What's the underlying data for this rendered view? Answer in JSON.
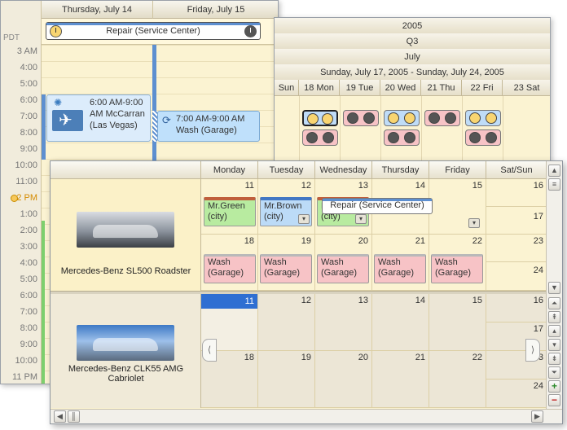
{
  "day_view": {
    "timezone": "PDT",
    "columns": [
      "Thursday, July 14",
      "Friday, July 15"
    ],
    "hours": [
      "3 AM",
      "4:00",
      "5:00",
      "6:00",
      "7:00",
      "8:00",
      "9:00",
      "10:00",
      "11:00",
      "2 PM",
      "1:00",
      "2:00",
      "3:00",
      "4:00",
      "5:00",
      "6:00",
      "7:00",
      "8:00",
      "9:00",
      "10:00",
      "11 PM"
    ],
    "allday_appt": "Repair (Service Center)",
    "appt_flight": "6:00 AM-9:00 AM McCarran (Las Vegas)",
    "appt_wash": "7:00 AM-9:00 AM Wash (Garage)"
  },
  "week_view": {
    "year": "2005",
    "quarter": "Q3",
    "month": "July",
    "range": "Sunday, July 17, 2005 - Sunday, July 24, 2005",
    "days": [
      "Sun",
      "18 Mon",
      "19 Tue",
      "20 Wed",
      "21 Thu",
      "22 Fri",
      "23 Sat"
    ]
  },
  "timeline": {
    "headers": [
      "Monday",
      "Tuesday",
      "Wednesday",
      "Thursday",
      "Friday",
      "Sat/Sun"
    ],
    "resources": [
      {
        "name": "Mercedes-Benz SL500 Roadster",
        "week1": [
          "11",
          "12",
          "13",
          "14",
          "15"
        ],
        "week1_weekend": [
          "16",
          "17"
        ],
        "week2": [
          "18",
          "19",
          "20",
          "21",
          "22"
        ],
        "week2_weekend": [
          "23",
          "24"
        ]
      },
      {
        "name": "Mercedes-Benz CLK55 AMG Cabriolet",
        "week1": [
          "11",
          "12",
          "13",
          "14",
          "15"
        ],
        "week1_weekend": [
          "16",
          "17"
        ],
        "week2": [
          "18",
          "19",
          "20",
          "21",
          "22"
        ],
        "week2_weekend": [
          "23",
          "24"
        ]
      }
    ],
    "events": {
      "mon": "Mr.Green (city)",
      "tue": "Mr.Brown (city)",
      "wed": "Mr.White (city)",
      "repair": "Repair (Service Center)",
      "wash": "Wash (Garage)"
    }
  },
  "colors": {
    "accent": "#2f6fd2",
    "pink": "#f7c3c6",
    "green": "#b8eba0",
    "blue": "#bcdbf7",
    "cream": "#fbf3d2"
  }
}
